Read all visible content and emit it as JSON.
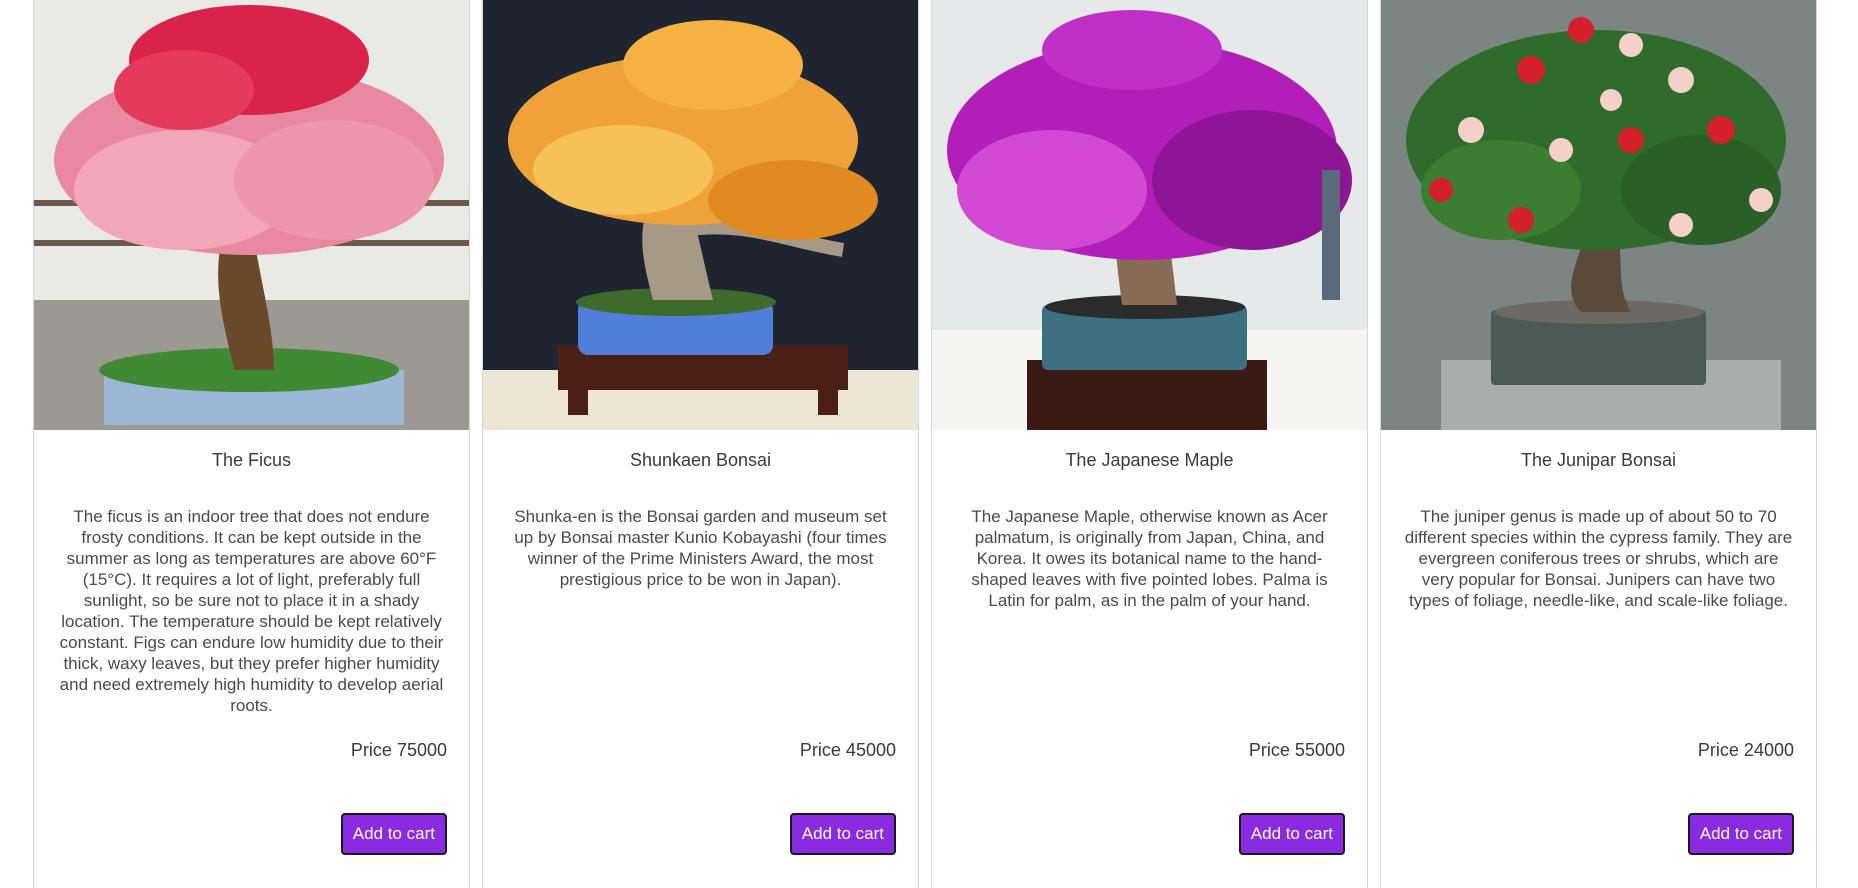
{
  "products": [
    {
      "image_alt": "Ficus bonsai with pink and red blossoms",
      "title": "The Ficus",
      "description": "The ficus is an indoor tree that does not endure frosty conditions. It can be kept outside in the summer as long as temperatures are above 60°F (15°C). It requires a lot of light, preferably full sunlight, so be sure not to place it in a shady location. The temperature should be kept relatively constant. Figs can endure low humidity due to their thick, waxy leaves, but they prefer higher humidity and need extremely high humidity to develop aerial roots.",
      "price": "Price 75000",
      "button": "Add to cart",
      "foliage_colors": [
        "#e8899f",
        "#d9234a",
        "#f4a6b9"
      ],
      "background": "#e9e9e6"
    },
    {
      "image_alt": "Shunkaen bonsai with orange blossoms in blue pot",
      "title": "Shunkaen Bonsai",
      "description": "Shunka-en is the Bonsai garden and museum set up by Bonsai master Kunio Kobayashi (four times winner of the Prime Ministers Award, the most prestigious price to be won in Japan).",
      "price": "Price 45000",
      "button": "Add to cart",
      "foliage_colors": [
        "#f0a23a",
        "#e08a1f",
        "#f7c15a"
      ],
      "background": "#1f2530"
    },
    {
      "image_alt": "Japanese maple bonsai with magenta blossoms",
      "title": "The Japanese Maple",
      "description": "The Japanese Maple, otherwise known as Acer palmatum, is originally from Japan, China, and Korea. It owes its botanical name to the hand-shaped leaves with five pointed lobes. Palma is Latin for palm, as in the palm of your hand.",
      "price": "Price 55000",
      "button": "Add to cart",
      "foliage_colors": [
        "#b21fb8",
        "#8e1596",
        "#d24ad4"
      ],
      "background": "#e6e9ea"
    },
    {
      "image_alt": "Juniper bonsai with red and white camellia flowers",
      "title": "The Junipar Bonsai",
      "description": "The juniper genus is made up of about 50 to 70 different species within the cypress family. They are evergreen coniferous trees or shrubs, which are very popular for Bonsai. Junipers can have two types of foliage, needle-like, and scale-like foliage.",
      "price": "Price 24000",
      "button": "Add to cart",
      "foliage_colors": [
        "#2f6b2a",
        "#d4202a",
        "#f4d0c8"
      ],
      "background": "#7b8683"
    }
  ],
  "accent_color": "#8a2be2"
}
